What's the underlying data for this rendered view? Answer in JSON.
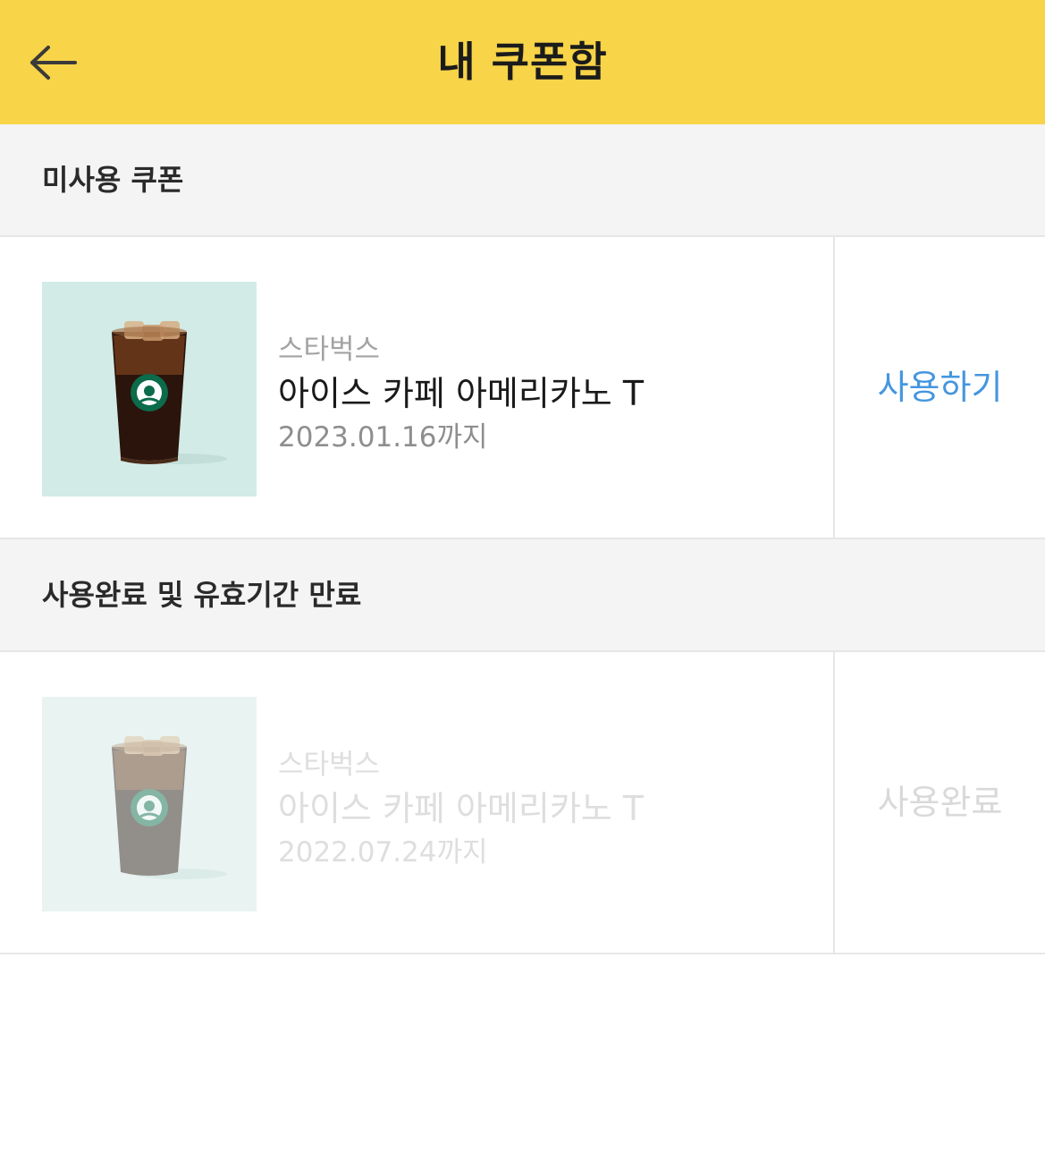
{
  "header": {
    "title": "내 쿠폰함",
    "back_icon": "arrow-left-icon",
    "background": "#f7d448"
  },
  "sections": [
    {
      "label": "미사용 쿠폰",
      "coupon": {
        "brand": "스타벅스",
        "product": "아이스 카페 아메리카노 T",
        "expiry": "2023.01.16까지",
        "action": "사용하기",
        "action_color": "#4596df",
        "image": "iced-americano-cup-image"
      }
    },
    {
      "label": "사용완료 및 유효기간 만료",
      "coupon": {
        "brand": "스타벅스",
        "product": "아이스 카페 아메리카노 T",
        "expiry": "2022.07.24까지",
        "action": "사용완료",
        "action_color": "#d9d9d9",
        "image": "iced-americano-cup-image"
      }
    }
  ]
}
